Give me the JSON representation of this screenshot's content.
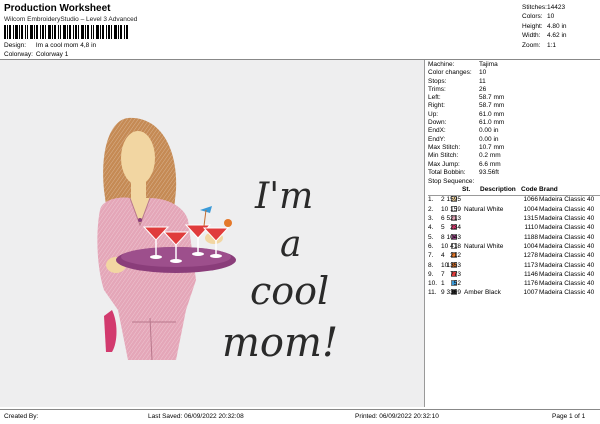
{
  "header": {
    "title": "Production Worksheet",
    "subtitle": "Wilcom EmbroideryStudio – Level 3 Advanced",
    "design_label": "Design:",
    "design_value": "Im a cool mom 4,8 in",
    "colorway_label": "Colorway:",
    "colorway_value": "Colorway 1"
  },
  "stats": [
    {
      "label": "Stitches:",
      "value": "14423"
    },
    {
      "label": "Colors:",
      "value": "10"
    },
    {
      "label": "Height:",
      "value": "4.80 in"
    },
    {
      "label": "Width:",
      "value": "4.62 in"
    },
    {
      "label": "Zoom:",
      "value": "1:1"
    }
  ],
  "design_text": {
    "line1": "I'm",
    "line2": "a",
    "line3": "cool",
    "line4": "mom!"
  },
  "machine_info": [
    {
      "label": "Machine:",
      "value": "Tajima"
    },
    {
      "label": "Color changes:",
      "value": "10"
    },
    {
      "label": "Stops:",
      "value": "11"
    },
    {
      "label": "Trims:",
      "value": "26"
    },
    {
      "label": "Left:",
      "value": "58.7 mm"
    },
    {
      "label": "Right:",
      "value": "58.7 mm"
    },
    {
      "label": "Up:",
      "value": "61.0 mm"
    },
    {
      "label": "Down:",
      "value": "61.0 mm"
    },
    {
      "label": "EndX:",
      "value": "0.00 in"
    },
    {
      "label": "EndY:",
      "value": "0.00 in"
    },
    {
      "label": "Max Stitch:",
      "value": "10.7 mm"
    },
    {
      "label": "Min Stitch:",
      "value": "0.2 mm"
    },
    {
      "label": "Max Jump:",
      "value": "6.6 mm"
    },
    {
      "label": "Total Bobbin:",
      "value": "93.56ft"
    }
  ],
  "sequence": {
    "title": "Stop Sequence:",
    "headers": {
      "st": "St.",
      "desc": "Description",
      "code": "Code",
      "brand": "Brand"
    },
    "rows": [
      {
        "n": "1.",
        "s": "2",
        "color": "#f2d6a2",
        "st": "1595",
        "desc": "",
        "code": "1066",
        "brand": "Madeira Classic 40"
      },
      {
        "n": "2.",
        "s": "10",
        "color": "#ffffff",
        "st": "159",
        "desc": "Natural White",
        "code": "1004",
        "brand": "Madeira Classic 40"
      },
      {
        "n": "3.",
        "s": "6",
        "color": "#e4a6b8",
        "st": "5213",
        "desc": "",
        "code": "1315",
        "brand": "Madeira Classic 40"
      },
      {
        "n": "4.",
        "s": "5",
        "color": "#d23a6e",
        "st": "234",
        "desc": "",
        "code": "1110",
        "brand": "Madeira Classic 40"
      },
      {
        "n": "5.",
        "s": "8",
        "color": "#8a3d7a",
        "st": "1043",
        "desc": "",
        "code": "1188",
        "brand": "Madeira Classic 40"
      },
      {
        "n": "6.",
        "s": "10",
        "color": "#ffffff",
        "st": "418",
        "desc": "Natural White",
        "code": "1004",
        "brand": "Madeira Classic 40"
      },
      {
        "n": "7.",
        "s": "4",
        "color": "#e4782a",
        "st": "212",
        "desc": "",
        "code": "1278",
        "brand": "Madeira Classic 40"
      },
      {
        "n": "8.",
        "s": "10",
        "color": "#c56a2c",
        "st": "1353",
        "desc": "",
        "code": "1173",
        "brand": "Madeira Classic 40"
      },
      {
        "n": "9.",
        "s": "7",
        "color": "#e03c3c",
        "st": "773",
        "desc": "",
        "code": "1146",
        "brand": "Madeira Classic 40"
      },
      {
        "n": "10.",
        "s": "1",
        "color": "#3a9ad8",
        "st": "52",
        "desc": "",
        "code": "1176",
        "brand": "Madeira Classic 40"
      },
      {
        "n": "11.",
        "s": "9",
        "color": "#2a2a2a",
        "st": "3369",
        "desc": "Amber Black",
        "code": "1007",
        "brand": "Madeira Classic 40"
      }
    ]
  },
  "footer": {
    "created": "Created By:",
    "saved": "Last Saved: 06/09/2022 20:32:08",
    "printed": "Printed: 06/09/2022 20:32:10",
    "page": "Page 1 of 1"
  }
}
